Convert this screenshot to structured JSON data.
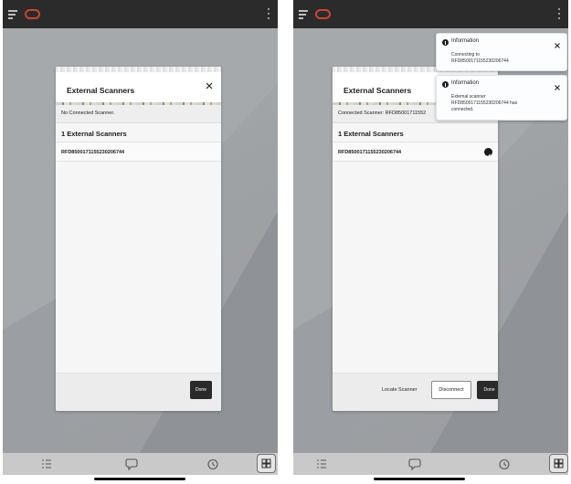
{
  "left_screen": {
    "dialog": {
      "title": "External Scanners",
      "status": "No Connected Scanner.",
      "list_heading": "1 External Scanners",
      "scanners": [
        "RFD8500171155230206744"
      ],
      "done_label": "Done"
    }
  },
  "right_screen": {
    "dialog": {
      "title": "External Scanners",
      "status": "Connected Scanner: RFD85001711552",
      "list_heading": "1 External Scanners",
      "scanners": [
        "RFD8500171155230206744"
      ],
      "locate_label": "Locate Scanner",
      "disconnect_label": "Disconnect",
      "done_label": "Done"
    },
    "toasts": [
      {
        "title": "Information",
        "message_line1": "Connecting to",
        "message_line2": "RFD8500171155230206744"
      },
      {
        "title": "Information",
        "message_line1": "External scanner",
        "message_line2": "RFD8500171155230206744 has",
        "message_line3": "connected."
      }
    ]
  },
  "icons": {
    "menu": "hamburger-icon",
    "logo": "oracle-logo-icon",
    "more": "kebab-icon",
    "close": "close-icon",
    "checkmark": "check-circle-icon",
    "info": "info-icon",
    "bottom_nav": [
      "task-list-icon",
      "chat-bubble-icon",
      "history-icon",
      "scanner-grid-icon"
    ]
  },
  "colors": {
    "topbar": "#2b2b2b",
    "logo": "#c74634",
    "primary_button": "#2a2a2a",
    "bottom_nav": "#c9c9c9"
  }
}
